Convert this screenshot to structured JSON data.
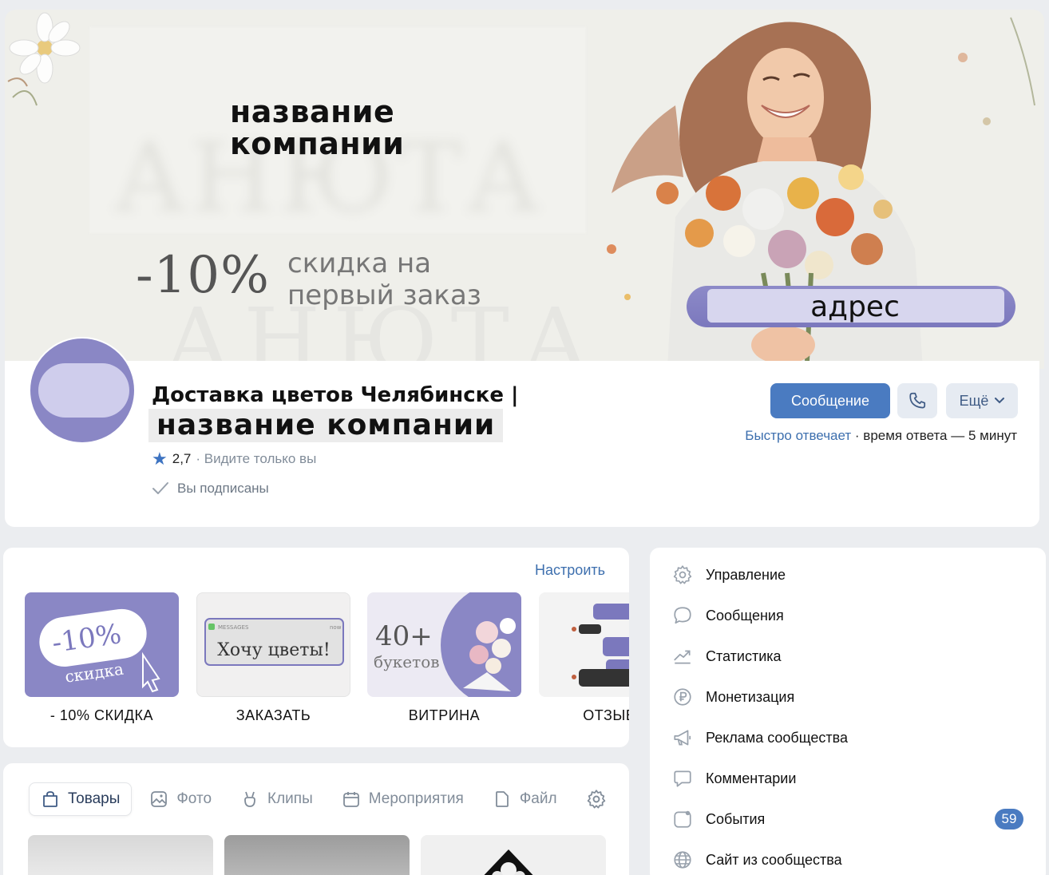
{
  "cover": {
    "title_line1": "название",
    "title_line2": "компании",
    "discount": "-10%",
    "discount_note_line1": "скидка на",
    "discount_note_line2": "первый заказ",
    "address": "адрес",
    "watermark": "АНЮТА"
  },
  "profile": {
    "title_line1": "Доставка цветов Челябинске |",
    "title_line2": "название компании",
    "rating": "2,7",
    "rating_note": "· Видите только вы",
    "subscribed": "Вы подписаны",
    "message_button": "Сообщение",
    "more_button": "Ещё",
    "response_fast": "Быстро отвечает",
    "response_time": "· время ответа — 5 минут"
  },
  "menu": {
    "configure": "Настроить",
    "items": [
      {
        "label": "- 10% СКИДКА",
        "image_text_1": "-10%",
        "image_text_2": "скидка"
      },
      {
        "label": "ЗАКАЗАТЬ",
        "image_text_1": "Хочу цветы!",
        "image_text_2": "MESSAGES",
        "image_text_3": "now"
      },
      {
        "label": "ВИТРИНА",
        "image_text_1": "40+",
        "image_text_2": "букетов"
      },
      {
        "label": "ОТЗЫВЫ"
      }
    ]
  },
  "tabs": [
    {
      "label": "Товары",
      "icon": "bag-icon",
      "active": true
    },
    {
      "label": "Фото",
      "icon": "photo-icon",
      "active": false
    },
    {
      "label": "Клипы",
      "icon": "clips-icon",
      "active": false
    },
    {
      "label": "Мероприятия",
      "icon": "calendar-icon",
      "active": false
    },
    {
      "label": "Файлы",
      "icon": "file-icon",
      "active": false
    }
  ],
  "nav": {
    "items": [
      {
        "label": "Управление",
        "icon": "gear-icon"
      },
      {
        "label": "Сообщения",
        "icon": "chat-icon"
      },
      {
        "label": "Статистика",
        "icon": "stats-icon"
      },
      {
        "label": "Монетизация",
        "icon": "ruble-icon"
      },
      {
        "label": "Реклама сообщества",
        "icon": "megaphone-icon"
      },
      {
        "label": "Комментарии",
        "icon": "comment-icon"
      },
      {
        "label": "События",
        "icon": "events-icon",
        "badge": "59"
      },
      {
        "label": "Сайт из сообщества",
        "icon": "globe-icon"
      }
    ]
  },
  "colors": {
    "accent": "#4a7bc1",
    "brand_purple": "#8a87c5",
    "link": "#3d6fae"
  }
}
